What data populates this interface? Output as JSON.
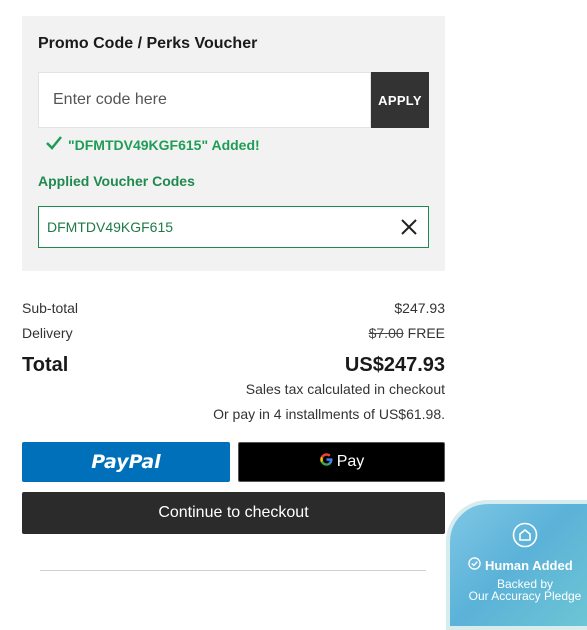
{
  "promo": {
    "title": "Promo Code / Perks Voucher",
    "input_placeholder": "Enter code here",
    "input_value": "",
    "apply_label": "APPLY",
    "success_message": "\"DFMTDV49KGF615\" Added!",
    "applied_label": "Applied Voucher Codes",
    "applied_code": "DFMTDV49KGF615"
  },
  "summary": {
    "subtotal_label": "Sub-total",
    "subtotal_value": "$247.93",
    "delivery_label": "Delivery",
    "delivery_original": "$7.00",
    "delivery_value": "FREE",
    "total_label": "Total",
    "total_value": "US$247.93",
    "tax_note": "Sales tax calculated in checkout",
    "installments_note": "Or pay in 4 installments of US$61.98."
  },
  "payment": {
    "paypal_label": "PayPal",
    "gpay_label": "Pay",
    "checkout_label": "Continue to checkout"
  },
  "badge": {
    "title": "Human Added",
    "subtitle_line1": "Backed by",
    "subtitle_line2": "Our Accuracy Pledge"
  },
  "colors": {
    "success_green": "#1f9d55",
    "paypal_blue": "#0070ba",
    "checkout_dark": "#2b2b2b"
  },
  "icons": [
    "checkmark-icon",
    "close-icon",
    "google-g-icon",
    "home-icon",
    "check-circle-icon"
  ]
}
